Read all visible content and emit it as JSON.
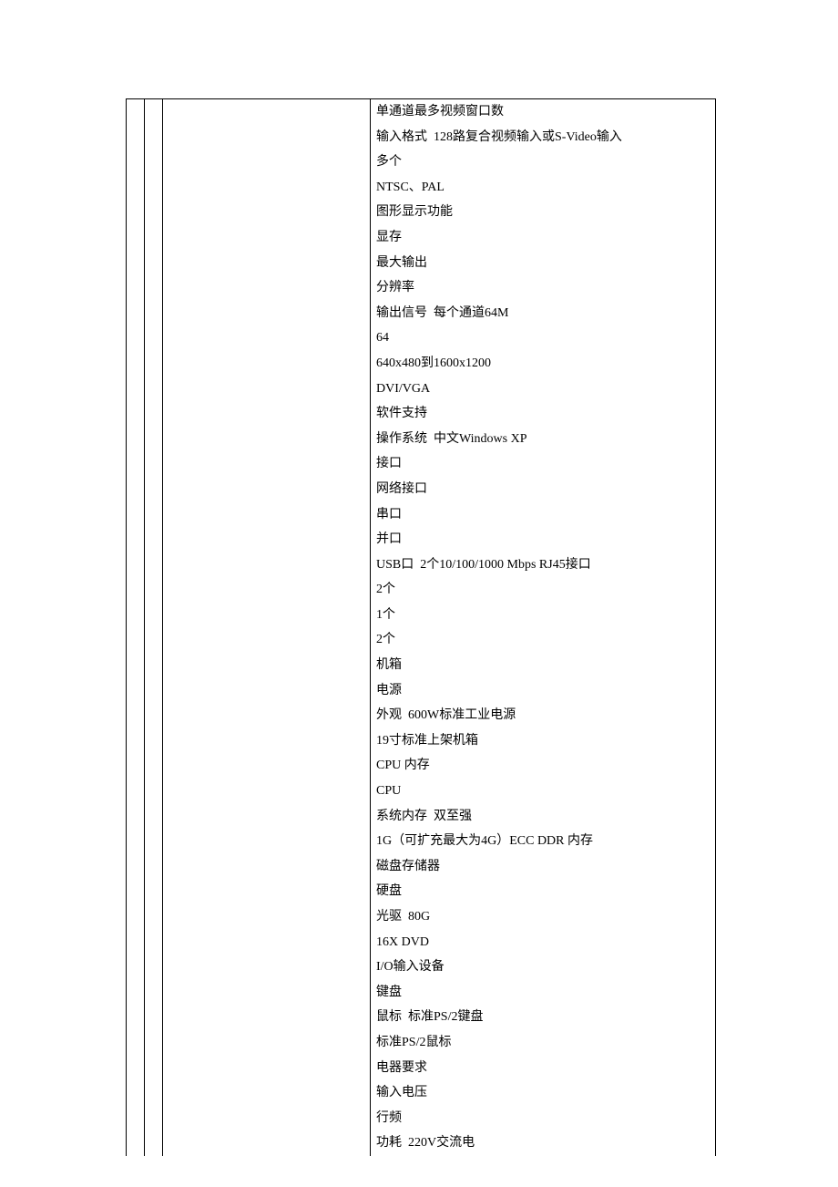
{
  "rows": [
    "单通道最多视频窗口数",
    "输入格式  128路复合视频输入或S-Video输入",
    "多个",
    "NTSC、PAL",
    "图形显示功能",
    "显存",
    "最大输出",
    "分辨率",
    "输出信号  每个通道64M",
    "64",
    "640x480到1600x1200",
    "DVI/VGA",
    "软件支持",
    "操作系统  中文Windows XP",
    "接口",
    "网络接口",
    "串口",
    "并口",
    "USB口  2个10/100/1000 Mbps RJ45接口",
    "2个",
    "1个",
    "2个",
    "机箱",
    "电源",
    "外观  600W标准工业电源",
    "19寸标准上架机箱",
    "CPU 内存",
    "CPU",
    "系统内存  双至强",
    "1G（可扩充最大为4G）ECC DDR 内存",
    "磁盘存储器",
    "硬盘",
    "光驱  80G",
    "16X DVD",
    "I/O输入设备",
    "键盘",
    "鼠标  标准PS/2键盘",
    "标准PS/2鼠标",
    "电器要求",
    "输入电压",
    "行频",
    "功耗  220V交流电"
  ]
}
